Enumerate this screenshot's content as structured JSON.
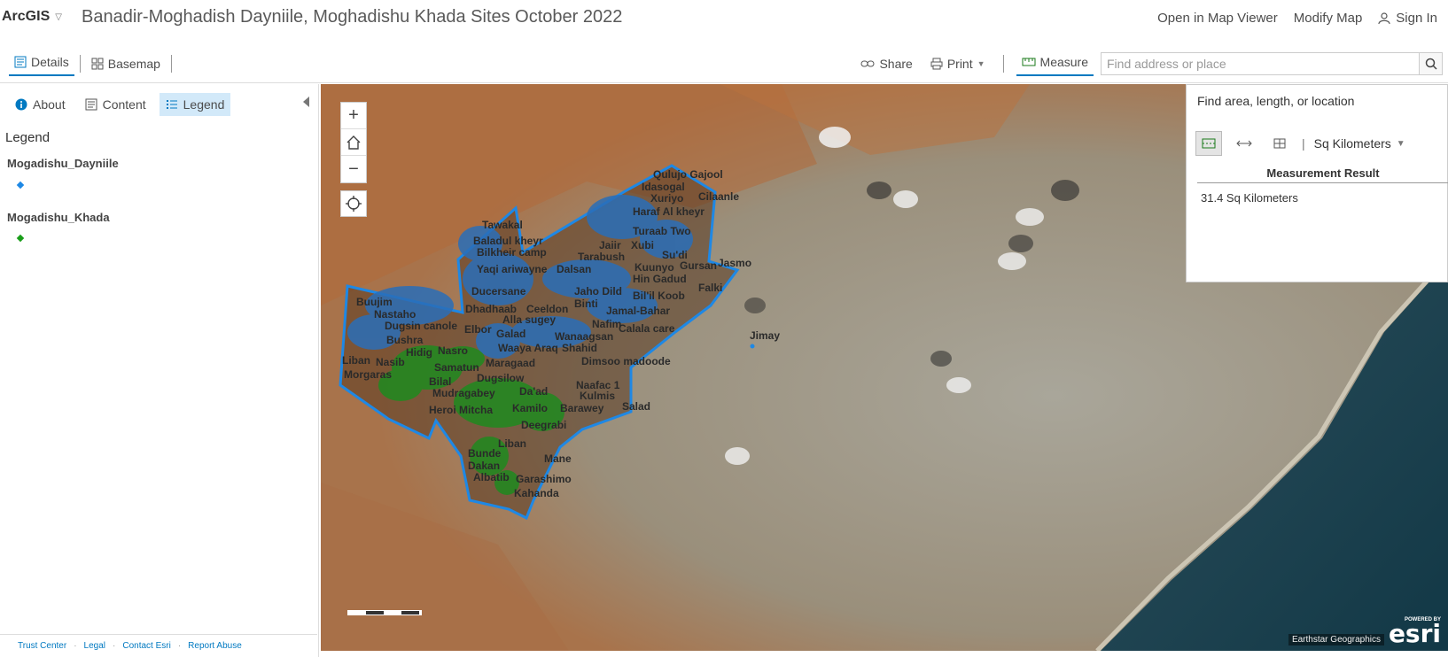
{
  "header": {
    "brand": "ArcGIS",
    "title": "Banadir-Moghadish Dayniile, Moghadishu Khada Sites October 2022",
    "open_map_viewer": "Open in Map Viewer",
    "modify_map": "Modify Map",
    "sign_in": "Sign In"
  },
  "toolbar": {
    "details": "Details",
    "basemap": "Basemap",
    "share": "Share",
    "print": "Print",
    "measure": "Measure",
    "search_placeholder": "Find address or place"
  },
  "left_panel": {
    "tabs": [
      "About",
      "Content",
      "Legend"
    ],
    "legend_heading": "Legend",
    "layers": [
      {
        "name": "Mogadishu_Dayniile",
        "color": "#1e88e5"
      },
      {
        "name": "Mogadishu_Khada",
        "color": "#1a9e1a"
      }
    ],
    "footer_links": [
      "Trust Center",
      "Legal",
      "Contact Esri",
      "Report Abuse"
    ]
  },
  "measure_panel": {
    "hint": "Find area, length, or location",
    "units": "Sq Kilometers",
    "result_title": "Measurement Result",
    "result_value": "31.4 Sq Kilometers"
  },
  "map": {
    "attribution": "Earthstar Geographics",
    "powered_by": "POWERED BY",
    "esri_logo": "esri",
    "outline_color": "#1e88e5",
    "place_labels": [
      "Qulujo Gajool",
      "Idasogal",
      "Xuriyo",
      "Cilaanle",
      "Haraf Al kheyr",
      "Tawakal",
      "Baladul kheyr",
      "Bilkheir camp",
      "Jaiir",
      "Tarabush",
      "Yaqi ariwayne",
      "Dalsan",
      "Turaab Two",
      "Xubi",
      "Su'di",
      "Kuunyo",
      "Gursan",
      "Jasmo",
      "Ducersane",
      "Jaho Dild",
      "Hin Gadud",
      "Binti",
      "Ceeldon",
      "Dhadhaab",
      "Alla sugey",
      "Bil'il Koob",
      "Jamal-Bahar",
      "Falki",
      "Nafim",
      "Buujim",
      "Nastaho",
      "Dugsin canole",
      "Elbor",
      "Galad",
      "Wanaagsan",
      "Calala care",
      "Bushra",
      "Hidig",
      "Nasro",
      "Waaya Araq",
      "Shahid",
      "Jimay",
      "Liban",
      "Nasib",
      "Samatun",
      "Maragaad",
      "Dimsoo madoode",
      "Morgaras",
      "Bilal",
      "Dugsilow",
      "Naafac 1",
      "Mudragabey",
      "Da'ad",
      "Kulmis",
      "Heroi Mitcha",
      "Kamilo",
      "Barawey",
      "Salad",
      "Deegrabi",
      "Liban",
      "Bunde",
      "Mane",
      "Dakan",
      "Albatib",
      "Garashimo",
      "Kahanda"
    ]
  }
}
